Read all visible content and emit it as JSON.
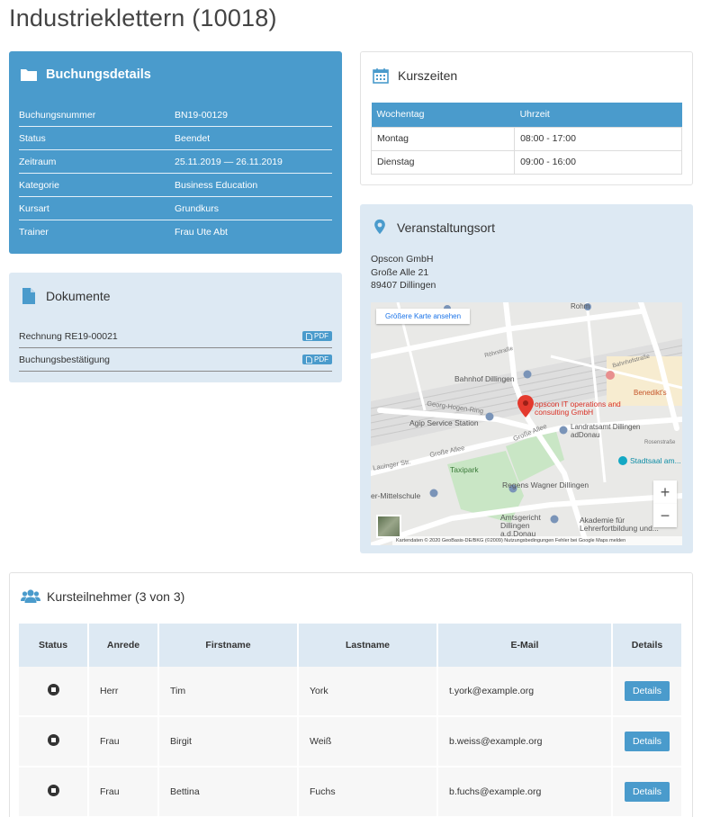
{
  "page": {
    "title": "Industrieklettern (10018)"
  },
  "colors": {
    "primary": "#4a9bcc",
    "light_panel": "#dde9f3"
  },
  "booking": {
    "heading": "Buchungsdetails",
    "icon": "folder-icon",
    "rows": [
      {
        "label": "Buchungsnummer",
        "value": "BN19-00129"
      },
      {
        "label": "Status",
        "value": "Beendet"
      },
      {
        "label": "Zeitraum",
        "value": "25.11.2019 — 26.11.2019"
      },
      {
        "label": "Kategorie",
        "value": "Business Education"
      },
      {
        "label": "Kursart",
        "value": "Grundkurs"
      },
      {
        "label": "Trainer",
        "value": "Frau Ute Abt"
      }
    ]
  },
  "documents": {
    "heading": "Dokumente",
    "icon": "document-icon",
    "items": [
      {
        "name": "Rechnung RE19-00021",
        "badge": "PDF"
      },
      {
        "name": "Buchungsbestätigung",
        "badge": "PDF"
      }
    ]
  },
  "course_times": {
    "heading": "Kurszeiten",
    "icon": "calendar-icon",
    "columns": [
      "Wochentag",
      "Uhrzeit"
    ],
    "rows": [
      {
        "day": "Montag",
        "time": "08:00 - 17:00"
      },
      {
        "day": "Dienstag",
        "time": "09:00 - 16:00"
      }
    ]
  },
  "venue": {
    "heading": "Veranstaltungsort",
    "icon": "map-pin-icon",
    "address": [
      "Opscon GmbH",
      "Große Alle 21",
      "89407 Dillingen"
    ],
    "map": {
      "larger_map_link": "Größere Karte ansehen",
      "zoom_in": "+",
      "zoom_out": "−",
      "footer": "Kartendaten © 2020 GeoBasis-DE/BKG (©2009)   Nutzungsbedingungen   Fehler bei Google Maps melden",
      "labels": {
        "marker": "opscon IT operations and consulting GmbH",
        "bahnhof": "Bahnhof Dillingen",
        "agip": "Agip Service Station",
        "landratsamt": "Landratsamt Dillingen adDonau",
        "taxipark": "Taxipark",
        "regens": "Regens Wagner Dillingen",
        "mittelschule": "er-Mittelschule",
        "amtsgericht": "Amtsgericht Dillingen a.d.Donau",
        "akademie": "Akademie für Lehrerfortbildung und...",
        "stadtsaal": "Stadtsaal am...",
        "benedikt": "Benedikt's",
        "georg": "Georg-Hogen-Ring",
        "grosse_allee": "Große Allee",
        "grosse_allee2": "Große Allee",
        "lauinger": "Lauinger Str.",
        "rohrstrasse": "Röhrstraße",
        "bahnhofstrasse": "Bahnhofstraße",
        "rosenstrasse": "Rosenstraße",
        "rohm": "Rohm"
      }
    }
  },
  "participants": {
    "heading": "Kursteilnehmer (3 von 3)",
    "icon": "users-icon",
    "columns": [
      "Status",
      "Anrede",
      "Firstname",
      "Lastname",
      "E-Mail",
      "Details"
    ],
    "rows": [
      {
        "salutation": "Herr",
        "firstname": "Tim",
        "lastname": "York",
        "email": "t.york@example.org",
        "details": "Details"
      },
      {
        "salutation": "Frau",
        "firstname": "Birgit",
        "lastname": "Weiß",
        "email": "b.weiss@example.org",
        "details": "Details"
      },
      {
        "salutation": "Frau",
        "firstname": "Bettina",
        "lastname": "Fuchs",
        "email": "b.fuchs@example.org",
        "details": "Details"
      }
    ]
  }
}
